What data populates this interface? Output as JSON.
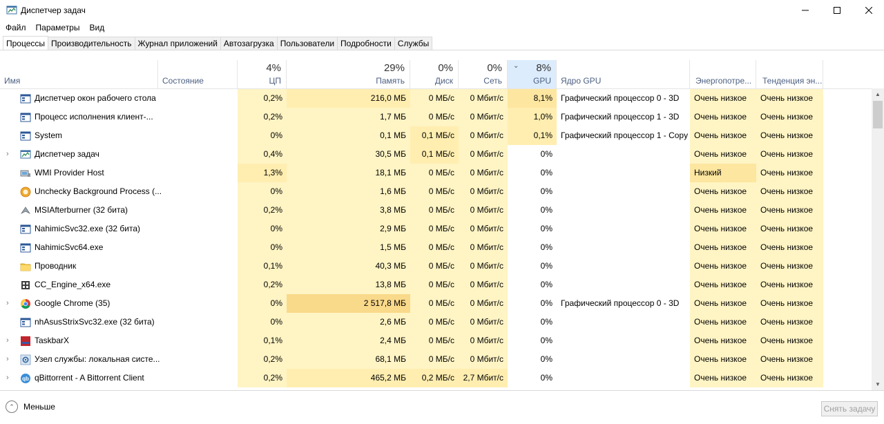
{
  "window": {
    "title": "Диспетчер задач",
    "app_icon": "task-manager-icon"
  },
  "menu": [
    "Файл",
    "Параметры",
    "Вид"
  ],
  "tabs": [
    {
      "label": "Процессы",
      "active": true
    },
    {
      "label": "Производительность",
      "active": false
    },
    {
      "label": "Журнал приложений",
      "active": false
    },
    {
      "label": "Автозагрузка",
      "active": false
    },
    {
      "label": "Пользователи",
      "active": false
    },
    {
      "label": "Подробности",
      "active": false
    },
    {
      "label": "Службы",
      "active": false
    }
  ],
  "columns": {
    "name": {
      "label": "Имя"
    },
    "status": {
      "label": "Состояние"
    },
    "cpu": {
      "label": "ЦП",
      "total": "4%"
    },
    "memory": {
      "label": "Память",
      "total": "29%"
    },
    "disk": {
      "label": "Диск",
      "total": "0%"
    },
    "network": {
      "label": "Сеть",
      "total": "0%"
    },
    "gpu": {
      "label": "GPU",
      "total": "8%",
      "sorted": true
    },
    "gpu_engine": {
      "label": "Ядро GPU"
    },
    "power": {
      "label": "Энергопотре..."
    },
    "power_trend": {
      "label": "Тенденция эн..."
    }
  },
  "processes": [
    {
      "name": "Диспетчер окон рабочего стола",
      "icon": "window-icon",
      "expandable": false,
      "cpu": "0,2%",
      "memory": "216,0 МБ",
      "disk": "0 МБ/с",
      "network": "0 Мбит/с",
      "gpu": "8,1%",
      "gpu_engine": "Графический процессор 0 - 3D",
      "power": "Очень низкое",
      "power_trend": "Очень низкое"
    },
    {
      "name": "Процесс исполнения клиент-...",
      "icon": "window-icon",
      "expandable": false,
      "cpu": "0,2%",
      "memory": "1,7 МБ",
      "disk": "0 МБ/с",
      "network": "0 Мбит/с",
      "gpu": "1,0%",
      "gpu_engine": "Графический процессор 1 - 3D",
      "power": "Очень низкое",
      "power_trend": "Очень низкое"
    },
    {
      "name": "System",
      "icon": "window-icon",
      "expandable": false,
      "cpu": "0%",
      "memory": "0,1 МБ",
      "disk": "0,1 МБ/с",
      "network": "0 Мбит/с",
      "gpu": "0,1%",
      "gpu_engine": "Графический процессор 1 - Copy",
      "power": "Очень низкое",
      "power_trend": "Очень низкое"
    },
    {
      "name": "Диспетчер задач",
      "icon": "task-manager-icon",
      "expandable": true,
      "cpu": "0,4%",
      "memory": "30,5 МБ",
      "disk": "0,1 МБ/с",
      "network": "0 Мбит/с",
      "gpu": "0%",
      "gpu_engine": "",
      "power": "Очень низкое",
      "power_trend": "Очень низкое"
    },
    {
      "name": "WMI Provider Host",
      "icon": "wmi-icon",
      "expandable": false,
      "cpu": "1,3%",
      "memory": "18,1 МБ",
      "disk": "0 МБ/с",
      "network": "0 Мбит/с",
      "gpu": "0%",
      "gpu_engine": "",
      "power": "Низкий",
      "power_trend": "Очень низкое"
    },
    {
      "name": "Unchecky Background Process (...",
      "icon": "unchecky-icon",
      "expandable": false,
      "cpu": "0%",
      "memory": "1,6 МБ",
      "disk": "0 МБ/с",
      "network": "0 Мбит/с",
      "gpu": "0%",
      "gpu_engine": "",
      "power": "Очень низкое",
      "power_trend": "Очень низкое"
    },
    {
      "name": "MSIAfterburner (32 бита)",
      "icon": "afterburner-icon",
      "expandable": false,
      "cpu": "0,2%",
      "memory": "3,8 МБ",
      "disk": "0 МБ/с",
      "network": "0 Мбит/с",
      "gpu": "0%",
      "gpu_engine": "",
      "power": "Очень низкое",
      "power_trend": "Очень низкое"
    },
    {
      "name": "NahimicSvc32.exe (32 бита)",
      "icon": "window-icon",
      "expandable": false,
      "cpu": "0%",
      "memory": "2,9 МБ",
      "disk": "0 МБ/с",
      "network": "0 Мбит/с",
      "gpu": "0%",
      "gpu_engine": "",
      "power": "Очень низкое",
      "power_trend": "Очень низкое"
    },
    {
      "name": "NahimicSvc64.exe",
      "icon": "window-icon",
      "expandable": false,
      "cpu": "0%",
      "memory": "1,5 МБ",
      "disk": "0 МБ/с",
      "network": "0 Мбит/с",
      "gpu": "0%",
      "gpu_engine": "",
      "power": "Очень низкое",
      "power_trend": "Очень низкое"
    },
    {
      "name": "Проводник",
      "icon": "folder-icon",
      "expandable": false,
      "cpu": "0,1%",
      "memory": "40,3 МБ",
      "disk": "0 МБ/с",
      "network": "0 Мбит/с",
      "gpu": "0%",
      "gpu_engine": "",
      "power": "Очень низкое",
      "power_trend": "Очень низкое"
    },
    {
      "name": "CC_Engine_x64.exe",
      "icon": "cc-engine-icon",
      "expandable": false,
      "cpu": "0,2%",
      "memory": "13,8 МБ",
      "disk": "0 МБ/с",
      "network": "0 Мбит/с",
      "gpu": "0%",
      "gpu_engine": "",
      "power": "Очень низкое",
      "power_trend": "Очень низкое"
    },
    {
      "name": "Google Chrome (35)",
      "icon": "chrome-icon",
      "expandable": true,
      "cpu": "0%",
      "memory": "2 517,8 МБ",
      "disk": "0 МБ/с",
      "network": "0 Мбит/с",
      "gpu": "0%",
      "gpu_engine": "Графический процессор 0 - 3D",
      "power": "Очень низкое",
      "power_trend": "Очень низкое"
    },
    {
      "name": "nhAsusStrixSvc32.exe (32 бита)",
      "icon": "window-icon",
      "expandable": false,
      "cpu": "0%",
      "memory": "2,6 МБ",
      "disk": "0 МБ/с",
      "network": "0 Мбит/с",
      "gpu": "0%",
      "gpu_engine": "",
      "power": "Очень низкое",
      "power_trend": "Очень низкое"
    },
    {
      "name": "TaskbarX",
      "icon": "taskbarx-icon",
      "expandable": true,
      "cpu": "0,1%",
      "memory": "2,4 МБ",
      "disk": "0 МБ/с",
      "network": "0 Мбит/с",
      "gpu": "0%",
      "gpu_engine": "",
      "power": "Очень низкое",
      "power_trend": "Очень низкое"
    },
    {
      "name": "Узел службы: локальная систе...",
      "icon": "service-gear-icon",
      "expandable": true,
      "cpu": "0,2%",
      "memory": "68,1 МБ",
      "disk": "0 МБ/с",
      "network": "0 Мбит/с",
      "gpu": "0%",
      "gpu_engine": "",
      "power": "Очень низкое",
      "power_trend": "Очень низкое"
    },
    {
      "name": "qBittorrent - A Bittorrent Client",
      "icon": "qbittorrent-icon",
      "expandable": true,
      "cpu": "0,2%",
      "memory": "465,2 МБ",
      "disk": "0,2 МБ/с",
      "network": "2,7 Мбит/с",
      "gpu": "0%",
      "gpu_engine": "",
      "power": "Очень низкое",
      "power_trend": "Очень низкое"
    }
  ],
  "footer": {
    "less_label": "Меньше",
    "end_task_label": "Снять задачу"
  },
  "colors": {
    "heat_light": "#fff4c4",
    "heat_medium": "#ffeeb0",
    "heat_strong": "#fde6a0",
    "heat_high": "#f9d98a",
    "sorted_header": "#dcecfc",
    "header_label": "#4d6082"
  }
}
